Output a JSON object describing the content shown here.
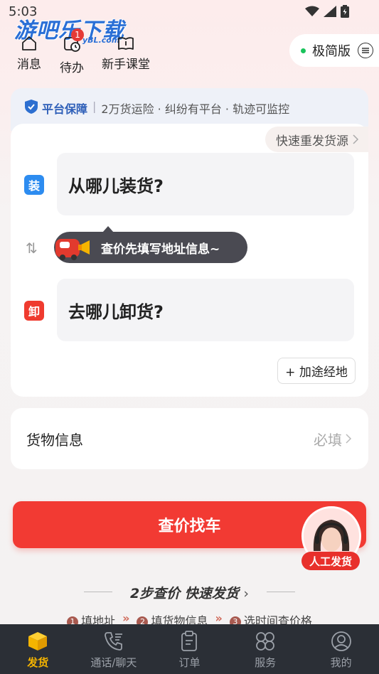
{
  "status_bar": {
    "time": "5:03"
  },
  "watermark": {
    "text": "游吧乐下载",
    "sub": "yBL.com"
  },
  "header": {
    "messages_label": "消息",
    "todo_label": "待办",
    "todo_badge": "1",
    "course_label": "新手课堂",
    "mode_label": "极简版"
  },
  "guarantee": {
    "title": "平台保障",
    "text": "2万货运险 · 纠纷有平台 · 轨迹可监控"
  },
  "address": {
    "quick_resend": "快速重发货源",
    "load_tag": "装",
    "load_placeholder": "从哪儿装货?",
    "unload_tag": "卸",
    "unload_placeholder": "去哪儿卸货?",
    "tooltip": "查价先填写地址信息~",
    "add_stop": "+ 加途经地"
  },
  "goods": {
    "label": "货物信息",
    "hint": "必填"
  },
  "primary_button": "查价找车",
  "agent_label": "人工发货",
  "steps": {
    "title": "2步查价 快速发货",
    "step1_num": "1",
    "step1": "填地址",
    "step2_num": "2",
    "step2": "填货物信息",
    "step3_num": "3",
    "step3": "选时间查价格"
  },
  "nav": {
    "ship": "发货",
    "chat": "通话/聊天",
    "orders": "订单",
    "services": "服务",
    "mine": "我的"
  },
  "colors": {
    "accent_red": "#f23a33",
    "nav_active": "#f5b400",
    "nav_bg": "#2b2f36",
    "load_tag": "#2d8cf0",
    "unload_tag": "#ef3b2f"
  }
}
